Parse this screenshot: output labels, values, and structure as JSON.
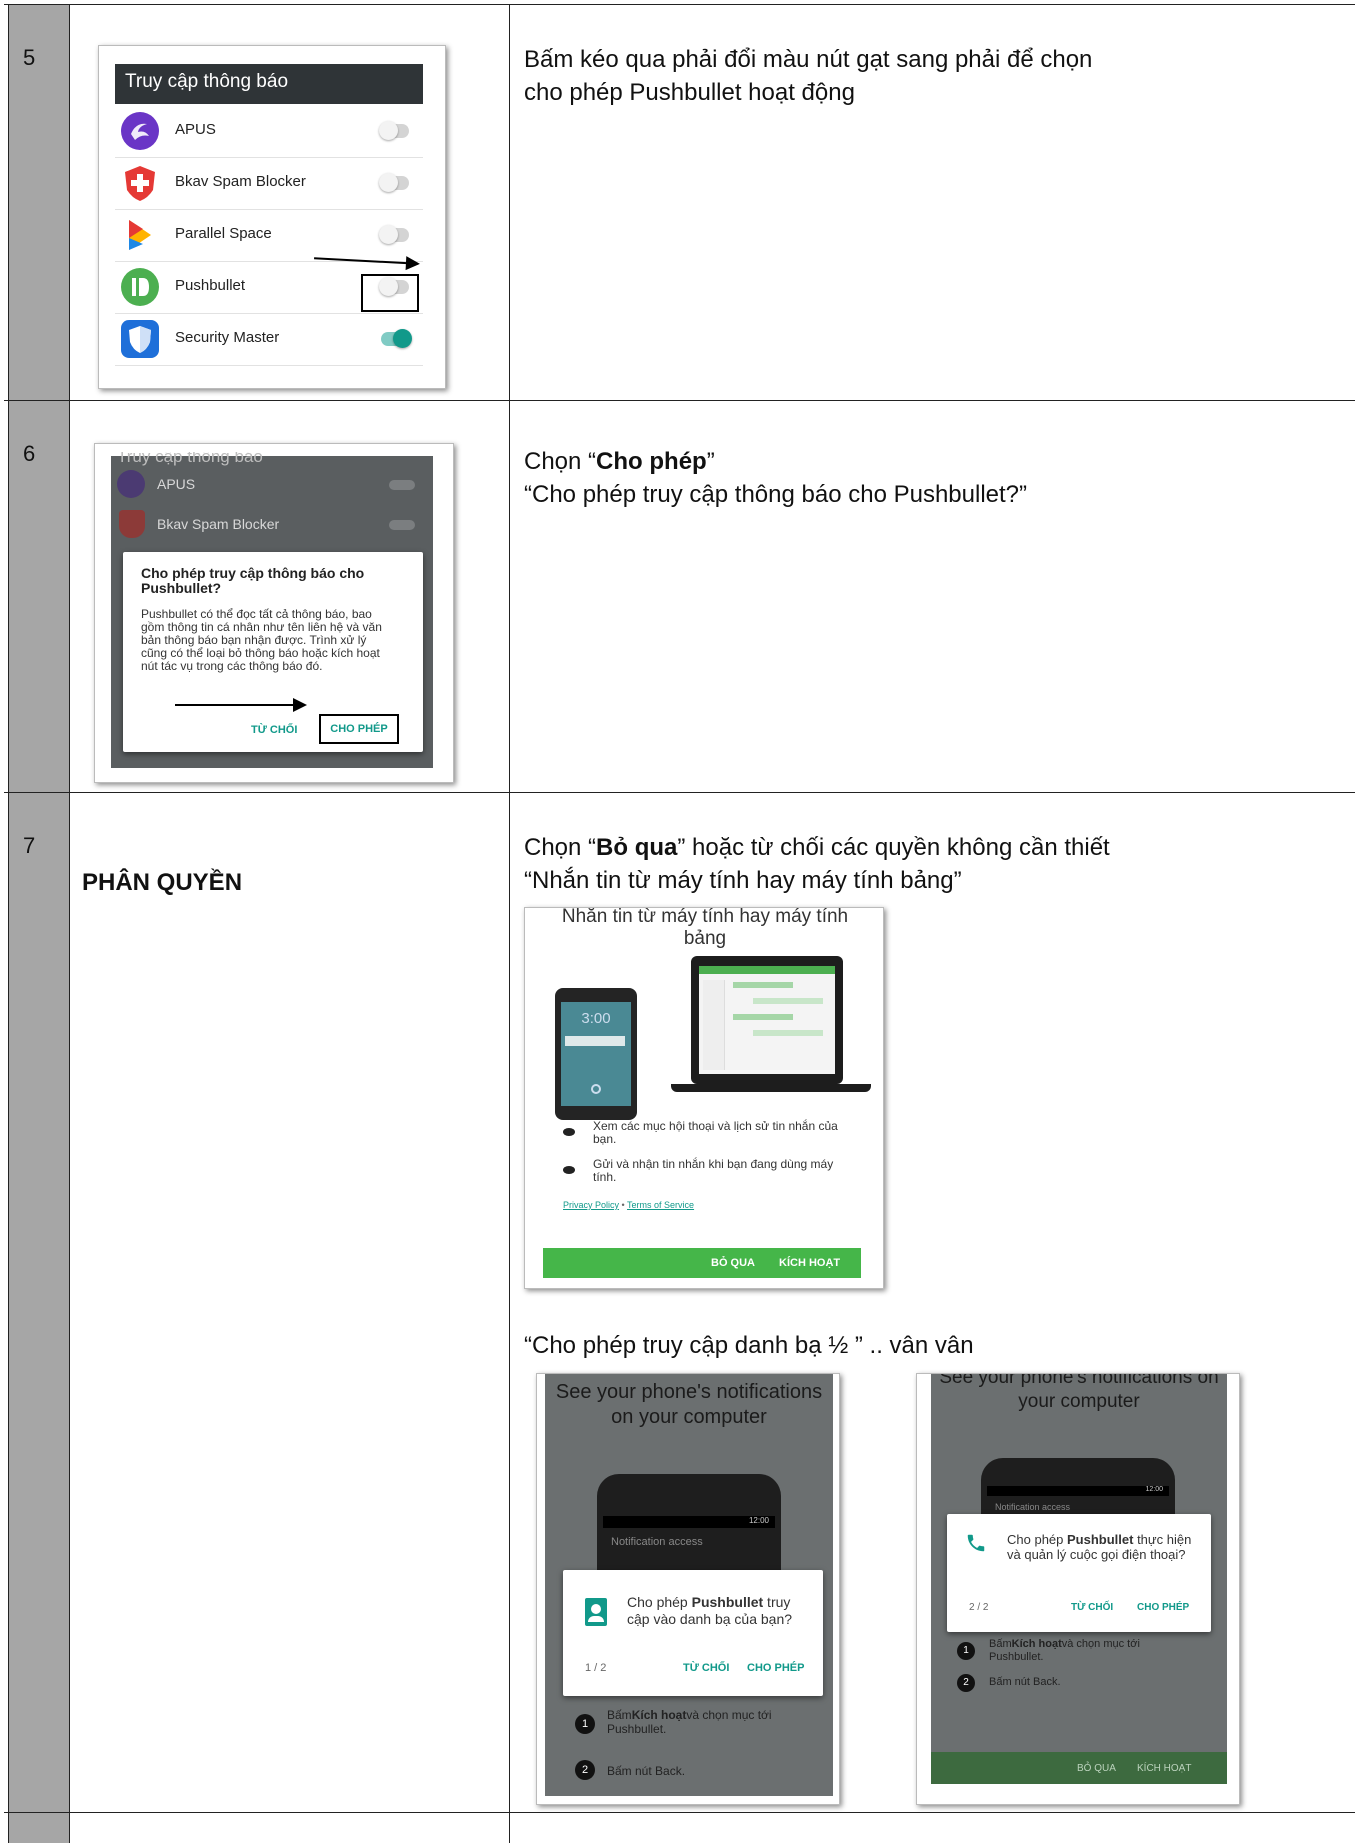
{
  "rows": {
    "r5": {
      "number": "5",
      "desc_line1": "Bấm kéo qua phải đổi màu nút gạt sang phải để chọn",
      "desc_line2": "cho phép Pushbullet hoạt động"
    },
    "r6": {
      "number": "6",
      "desc_prefix": "Chọn “",
      "desc_bold": "Cho phép",
      "desc_suffix": "”",
      "desc_line2": "“Cho phép truy cập thông báo cho Pushbullet?”"
    },
    "r7": {
      "number": "7",
      "title": "PHÂN QUYỀN",
      "desc_prefix": "Chọn “",
      "desc_bold": "Bỏ qua",
      "desc_suffix": "” hoặc từ chối các quyền không cần thiết",
      "desc_line2": "“Nhắn tin từ máy tính hay máy tính bảng”",
      "desc_line3": "“Cho phép truy cập danh bạ ½ ”  .. vân vân"
    }
  },
  "screen_notification_access": {
    "header": "Truy cập thông báo",
    "apps": [
      {
        "name": "APUS",
        "enabled": false,
        "color": "#6a35c6"
      },
      {
        "name": "Bkav Spam Blocker",
        "enabled": false,
        "color": "#e53935"
      },
      {
        "name": "Parallel Space",
        "enabled": false,
        "color": "#ffb300"
      },
      {
        "name": "Pushbullet",
        "enabled": false,
        "color": "#4caf50"
      },
      {
        "name": "Security Master",
        "enabled": true,
        "color": "#1e6fd9"
      }
    ]
  },
  "screen_allow_dialog": {
    "header": "Truy cập thông báo",
    "bg_items": [
      "APUS",
      "Bkav Spam Blocker"
    ],
    "dialog_title": "Cho phép truy cập thông báo cho Pushbullet?",
    "dialog_body": "Pushbullet có thể đọc tất cả thông báo, bao gồm thông tin cá nhân như tên liên hệ và văn bản thông báo bạn nhận được. Trình xử lý cũng có thể loại bỏ thông báo hoặc kích hoạt nút tác vụ trong các thông báo đó.",
    "deny": "TỪ CHỐI",
    "allow": "CHO PHÉP"
  },
  "screen_sms": {
    "title": "Nhắn tin từ máy tính hay máy tính bảng",
    "clock": "3:00",
    "bullet1": "Xem các mục hội thoại và lịch sử tin nhắn của bạn.",
    "bullet2": "Gửi và nhận tin nhắn khi bạn đang dùng máy tính.",
    "privacy": "Privacy Policy",
    "separator": "•",
    "terms": "Terms of Service",
    "skip": "BỎ QUA",
    "activate": "KÍCH HOẠT"
  },
  "screen_contacts": {
    "title": "See your phone's notifications on your computer",
    "time": "12:00",
    "notif_access": "Notification access",
    "prompt_prefix": "Cho phép ",
    "prompt_app": "Pushbullet",
    "prompt_suffix": " truy cập vào danh bạ của bạn?",
    "counter": "1 / 2",
    "deny": "TỪ CHỐI",
    "allow": "CHO PHÉP",
    "step1_prefix": "Bấm",
    "step1_bold": "Kích hoạt",
    "step1_suffix": "và chọn mục tới Pushbullet.",
    "step2": "Bấm nút Back."
  },
  "screen_calls": {
    "title": "See your phone's notifications on your computer",
    "time": "12:00",
    "notif_access": "Notification access",
    "prompt_prefix": "Cho phép ",
    "prompt_app": "Pushbullet",
    "prompt_suffix": " thực hiện và quản lý cuộc gọi điện thoại?",
    "counter": "2 / 2",
    "deny": "TỪ CHỐI",
    "allow": "CHO PHÉP",
    "step1_prefix": "Bấm",
    "step1_bold": "Kích hoạt",
    "step1_suffix": "và chọn mục tới Pushbullet.",
    "step2": "Bấm nút Back.",
    "skip": "BỎ QUA",
    "activate": "KÍCH HOẠT"
  }
}
